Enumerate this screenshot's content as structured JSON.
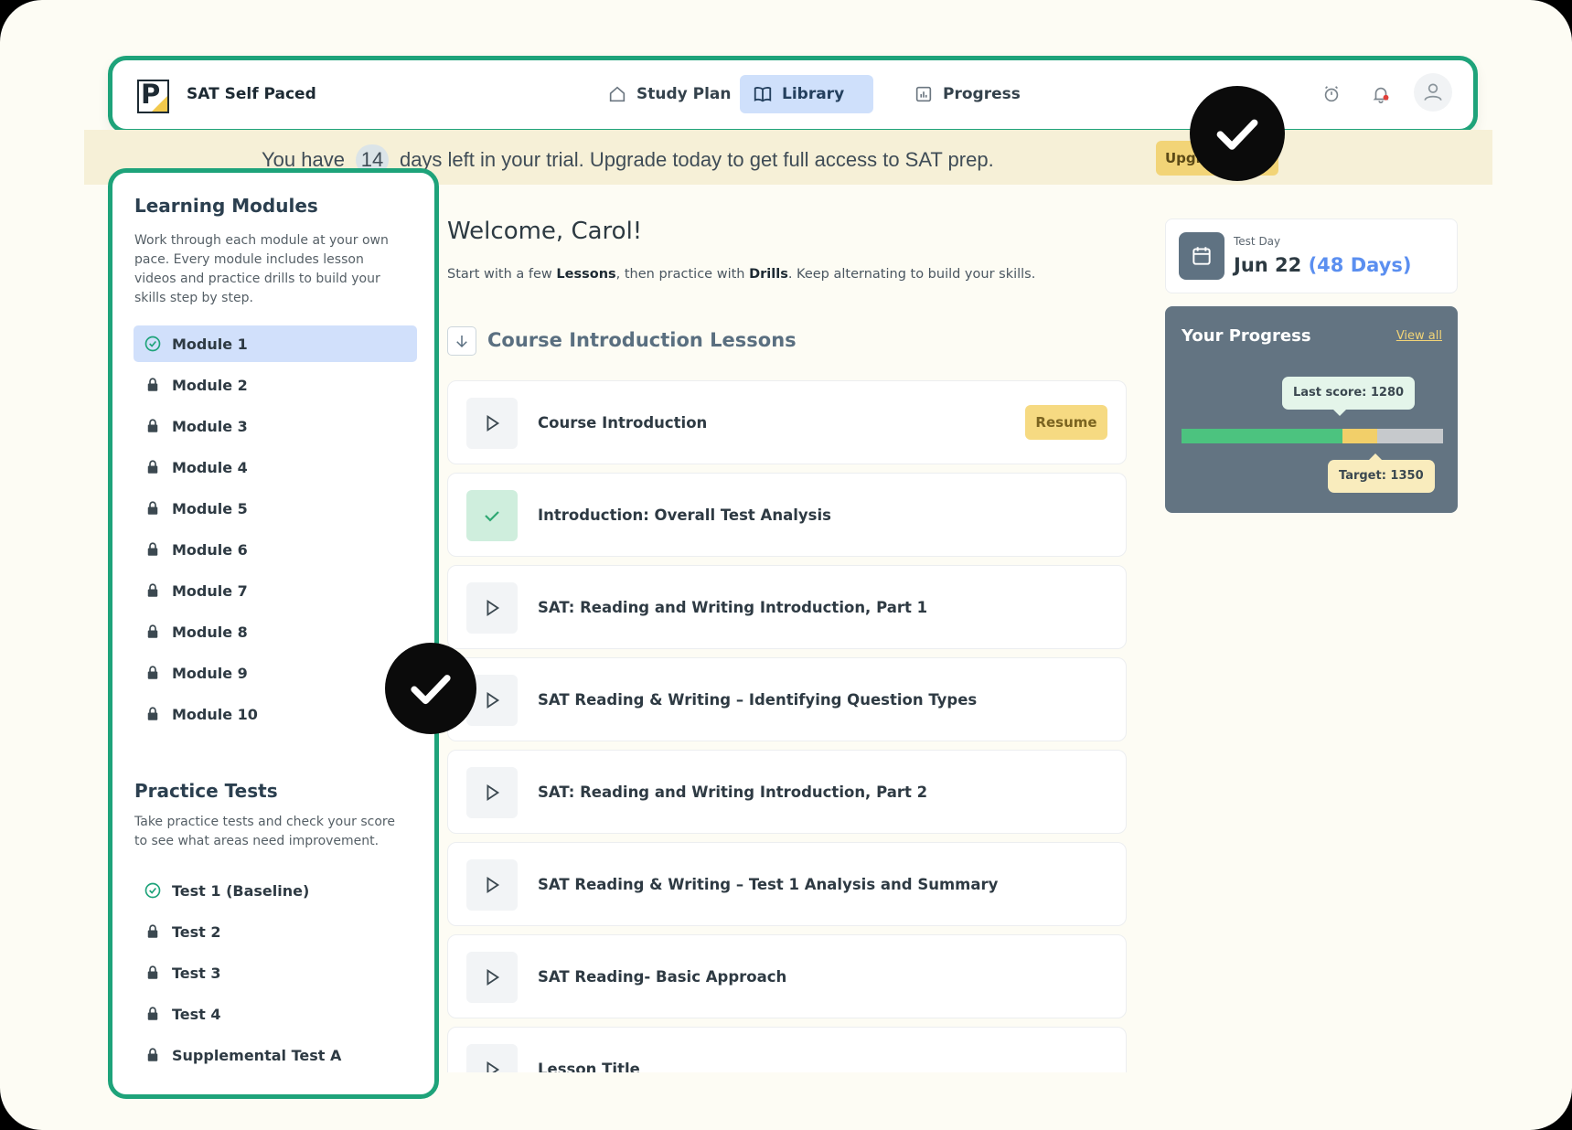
{
  "header": {
    "app_title": "SAT Self Paced",
    "logo_letter": "P",
    "tabs": [
      {
        "label": "Study Plan",
        "icon": "home-icon"
      },
      {
        "label": "Library",
        "icon": "book-icon",
        "active": true
      },
      {
        "label": "Progress",
        "icon": "chart-icon"
      }
    ],
    "icons": [
      "timer-icon",
      "bell-icon",
      "user-avatar-icon"
    ],
    "notification_dot_color": "#e0403a"
  },
  "banner": {
    "prefix": "You have",
    "days": "14",
    "suffix": "days left in your trial. Upgrade today to get full access to SAT prep.",
    "upgrade_label": "Upgrade Now"
  },
  "sidebar": {
    "modules_heading": "Learning Modules",
    "modules_description": "Work through each module at your own pace. Every module includes lesson videos and practice drills to build your skills step by step.",
    "modules": [
      {
        "label": "Module 1",
        "status": "completed",
        "active": true
      },
      {
        "label": "Module 2",
        "status": "locked"
      },
      {
        "label": "Module 3",
        "status": "locked"
      },
      {
        "label": "Module 4",
        "status": "locked"
      },
      {
        "label": "Module 5",
        "status": "locked"
      },
      {
        "label": "Module 6",
        "status": "locked"
      },
      {
        "label": "Module 7",
        "status": "locked"
      },
      {
        "label": "Module 8",
        "status": "locked"
      },
      {
        "label": "Module 9",
        "status": "locked"
      },
      {
        "label": "Module 10",
        "status": "locked"
      }
    ],
    "tests_heading": "Practice Tests",
    "tests_description": "Take practice tests and check your score to see what areas need improvement.",
    "tests": [
      {
        "label": "Test 1 (Baseline)",
        "status": "completed"
      },
      {
        "label": "Test 2",
        "status": "locked"
      },
      {
        "label": "Test 3",
        "status": "locked"
      },
      {
        "label": "Test 4",
        "status": "locked"
      },
      {
        "label": "Supplemental Test A",
        "status": "locked"
      }
    ]
  },
  "main": {
    "welcome": "Welcome, Carol!",
    "intro_parts": [
      "Start with a few ",
      "Lessons",
      ", then practice with ",
      "Drills",
      ". Keep alternating to build your skills."
    ],
    "section_title": "Course Introduction Lessons",
    "lessons": [
      {
        "title": "Course Introduction",
        "status": "in-progress",
        "action": "Resume"
      },
      {
        "title": "Introduction: Overall Test Analysis",
        "status": "completed"
      },
      {
        "title": "SAT: Reading and Writing Introduction, Part 1",
        "status": "not-started"
      },
      {
        "title": "SAT Reading & Writing – Identifying Question Types",
        "status": "not-started"
      },
      {
        "title": "SAT: Reading and Writing Introduction, Part 2",
        "status": "not-started"
      },
      {
        "title": "SAT Reading & Writing – Test 1 Analysis and Summary",
        "status": "not-started"
      },
      {
        "title": "SAT Reading- Basic Approach",
        "status": "not-started"
      },
      {
        "title": "Lesson Title",
        "status": "not-started"
      }
    ]
  },
  "test_day": {
    "label": "Test Day",
    "date": "Jun 22",
    "days_left": "(48 Days)"
  },
  "progress": {
    "title": "Your Progress",
    "view_all": "View all",
    "last_score_label": "Last score: 1280",
    "target_label": "Target: 1350",
    "score_min": 400,
    "score_max": 1600,
    "last_score": 1280,
    "target": 1350,
    "bar_green_fraction": 0.615,
    "bar_yellow_fraction": 0.135
  },
  "colors": {
    "accent_green": "#1ea37a",
    "active_tab_bg": "#cfe0fb",
    "upgrade_yellow": "#f2d477",
    "progress_card": "#637482",
    "days_blue": "#5b8ff0"
  },
  "overlay_badges": [
    "checkmark-badge-icon",
    "checkmark-badge-icon"
  ]
}
